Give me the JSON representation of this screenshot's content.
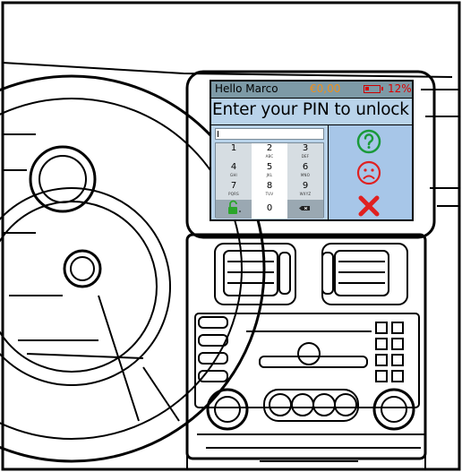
{
  "header": {
    "greeting": "Hello Marco",
    "balance": "€0,00",
    "battery_level": 0.3,
    "battery_text": "12%"
  },
  "prompt": {
    "title": "Enter your PIN to unlock"
  },
  "pin_field": {
    "value": ""
  },
  "keypad": {
    "keys": [
      {
        "num": "1",
        "letters": ""
      },
      {
        "num": "2",
        "letters": "ABC"
      },
      {
        "num": "3",
        "letters": "DEF"
      },
      {
        "num": "4",
        "letters": "GHI"
      },
      {
        "num": "5",
        "letters": "JKL"
      },
      {
        "num": "6",
        "letters": "MNO"
      },
      {
        "num": "7",
        "letters": "PQRS"
      },
      {
        "num": "8",
        "letters": "TUV"
      },
      {
        "num": "9",
        "letters": "WXYZ"
      },
      {
        "num": "0",
        "letters": ""
      }
    ],
    "unlock_icon": "open-padlock-icon",
    "delete_icon": "backspace-icon"
  },
  "actions": {
    "help_icon": "question-mark-icon",
    "sad_icon": "sad-face-icon",
    "cancel_icon": "close-icon",
    "colors": {
      "help": "#1a9a3a",
      "sad": "#e02020",
      "cancel": "#e02020"
    }
  }
}
